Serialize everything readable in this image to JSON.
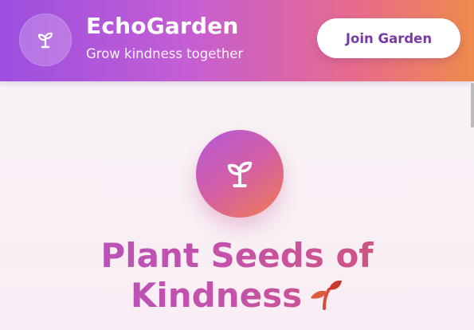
{
  "header": {
    "brand_title": "EchoGarden",
    "tagline": "Grow kindness together",
    "logo_icon": "sprout-icon",
    "join_button_label": "Join Garden"
  },
  "hero": {
    "icon": "sprout-icon",
    "title_line1": "Plant Seeds of",
    "title_line2": "Kindness",
    "title_emoji_icon": "seedling-emoji-icon"
  },
  "colors": {
    "header_gradient_start": "#9b4fe0",
    "header_gradient_end": "#ef8a4b",
    "button_text": "#7a3aa6",
    "title_gradient_start": "#b052c6",
    "title_gradient_end": "#d85468"
  }
}
